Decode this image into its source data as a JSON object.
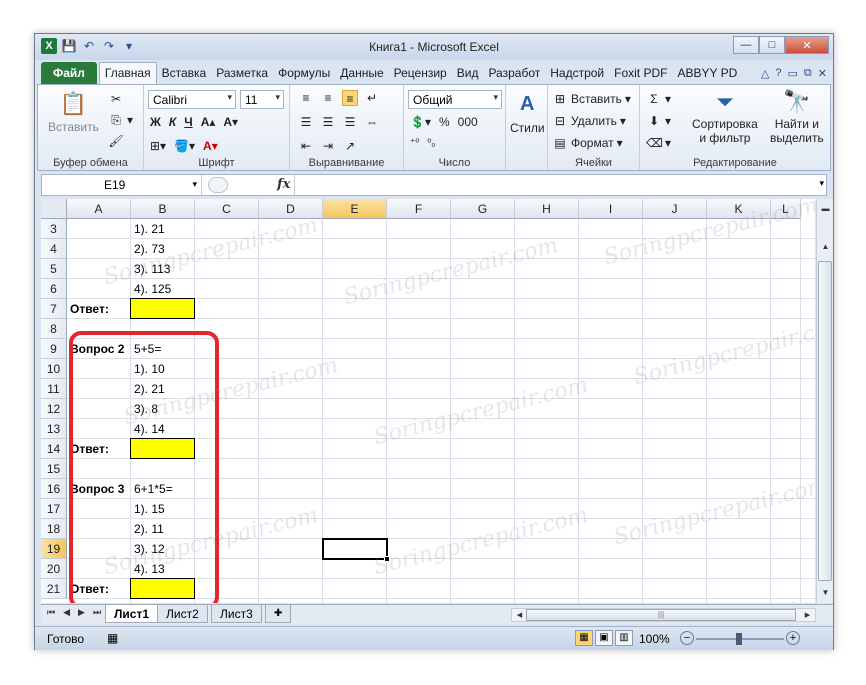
{
  "window": {
    "title": "Книга1 - Microsoft Excel",
    "controls": {
      "minimize": "—",
      "maximize": "□",
      "close": "✕"
    }
  },
  "qat": {
    "logo": "X",
    "save": "💾",
    "undo": "↶",
    "redo": "↷",
    "customize": "▾"
  },
  "tabs": [
    "Файл",
    "Главная",
    "Вставка",
    "Разметка",
    "Формулы",
    "Данные",
    "Рецензир",
    "Вид",
    "Разработ",
    "Надстрой",
    "Foxit PDF",
    "ABBYY PD"
  ],
  "ribbon": {
    "clipboard": {
      "label": "Буфер обмена",
      "paste": "Вставить"
    },
    "font": {
      "label": "Шрифт",
      "name": "Calibri",
      "size": "11",
      "bold": "Ж",
      "italic": "К",
      "underline": "Ч"
    },
    "alignment": {
      "label": "Выравнивание"
    },
    "number": {
      "label": "Число",
      "format": "Общий",
      "percent": "%",
      "thousands": "000",
      "increase": "⁺⁰",
      "decrease": "⁰₀"
    },
    "styles": {
      "label": "Стили"
    },
    "cells": {
      "label": "Ячейки",
      "insert": "Вставить",
      "delete": "Удалить",
      "format": "Формат"
    },
    "editing": {
      "label": "Редактирование",
      "sort_line1": "Сортировка",
      "sort_line2": "и фильтр",
      "find_line1": "Найти и",
      "find_line2": "выделить"
    }
  },
  "formula_bar": {
    "name_box": "E19",
    "fx": "fx",
    "value": ""
  },
  "columns": [
    "A",
    "B",
    "C",
    "D",
    "E",
    "F",
    "G",
    "H",
    "I",
    "J",
    "K",
    "L"
  ],
  "rows": [
    "3",
    "4",
    "5",
    "6",
    "7",
    "8",
    "9",
    "10",
    "11",
    "12",
    "13",
    "14",
    "15",
    "16",
    "17",
    "18",
    "19",
    "20",
    "21"
  ],
  "selected": {
    "column": "E",
    "row": "19"
  },
  "cells": {
    "B3": "1). 21",
    "B4": "2). 73",
    "B5": "3). 113",
    "B6": "4). 125",
    "A7": "Ответ:",
    "A9": "Вопрос 2",
    "B9": "5+5=",
    "B10": "1). 10",
    "B11": "2). 21",
    "B12": "3). 8",
    "B13": "4). 14",
    "A14": "Ответ:",
    "A16": "Вопрос 3",
    "B16": "6+1*5=",
    "B17": "1). 15",
    "B18": "2). 11",
    "B19": "3). 12",
    "B20": "4). 13",
    "A21": "Ответ:"
  },
  "answer_fill_color": "#ffff00",
  "highlight_color": "#e3262e",
  "sheets": [
    "Лист1",
    "Лист2",
    "Лист3"
  ],
  "status": {
    "ready": "Готово",
    "zoom": "100%"
  },
  "watermark": "Soringpcrepair.com"
}
